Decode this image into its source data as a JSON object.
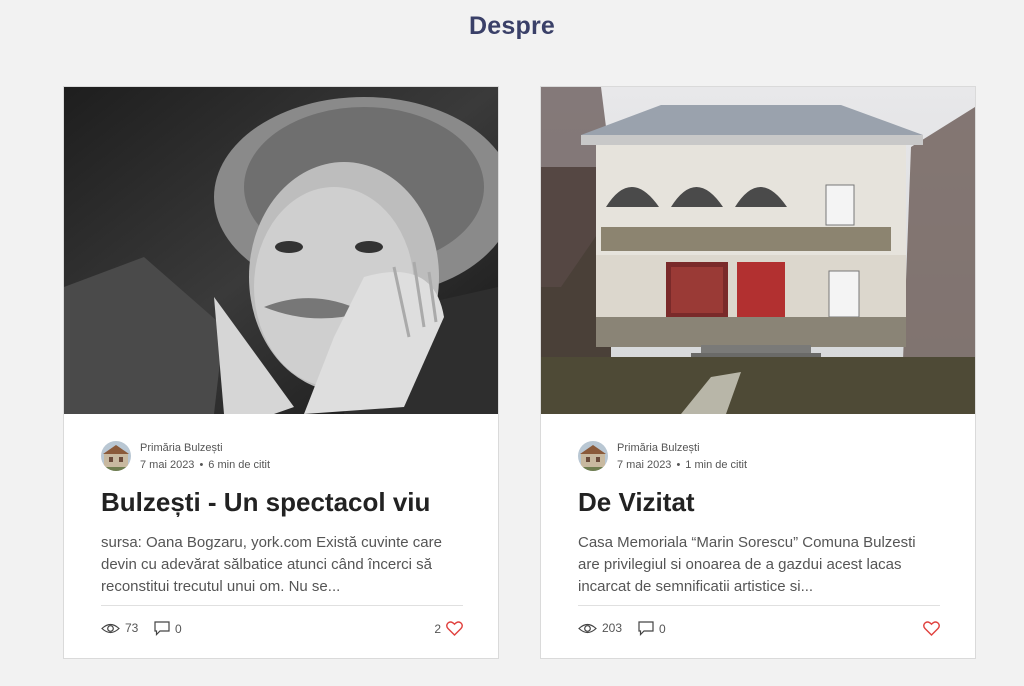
{
  "page": {
    "title": "Despre"
  },
  "posts": [
    {
      "author": "Primăria Bulzești",
      "date": "7 mai 2023",
      "separator": "•",
      "read_time": "6 min de citit",
      "title": "Bulzești - Un spectacol viu",
      "excerpt": "sursa: Oana Bogzaru, york.com Există cuvinte care devin cu adevărat sălbatice atunci când încerci să reconstitui trecutul unui om. Nu se...",
      "views": "73",
      "comments": "0",
      "likes": "2",
      "image_icon": "portrait-photo"
    },
    {
      "author": "Primăria Bulzești",
      "date": "7 mai 2023",
      "separator": "•",
      "read_time": "1 min de citit",
      "title": "De Vizitat",
      "excerpt": "Casa Memoriala “Marin Sorescu” Comuna Bulzesti are privilegiul si onoarea de a gazdui acest lacas incarcat de semnificatii artistice si...",
      "views": "203",
      "comments": "0",
      "likes": "",
      "image_icon": "house-photo"
    }
  ],
  "colors": {
    "title": "#3a4068",
    "heart": "#e0413e",
    "background": "#f2f2f2"
  },
  "icons": {
    "views": "eye-icon",
    "comments": "comment-icon",
    "likes": "heart-icon"
  }
}
